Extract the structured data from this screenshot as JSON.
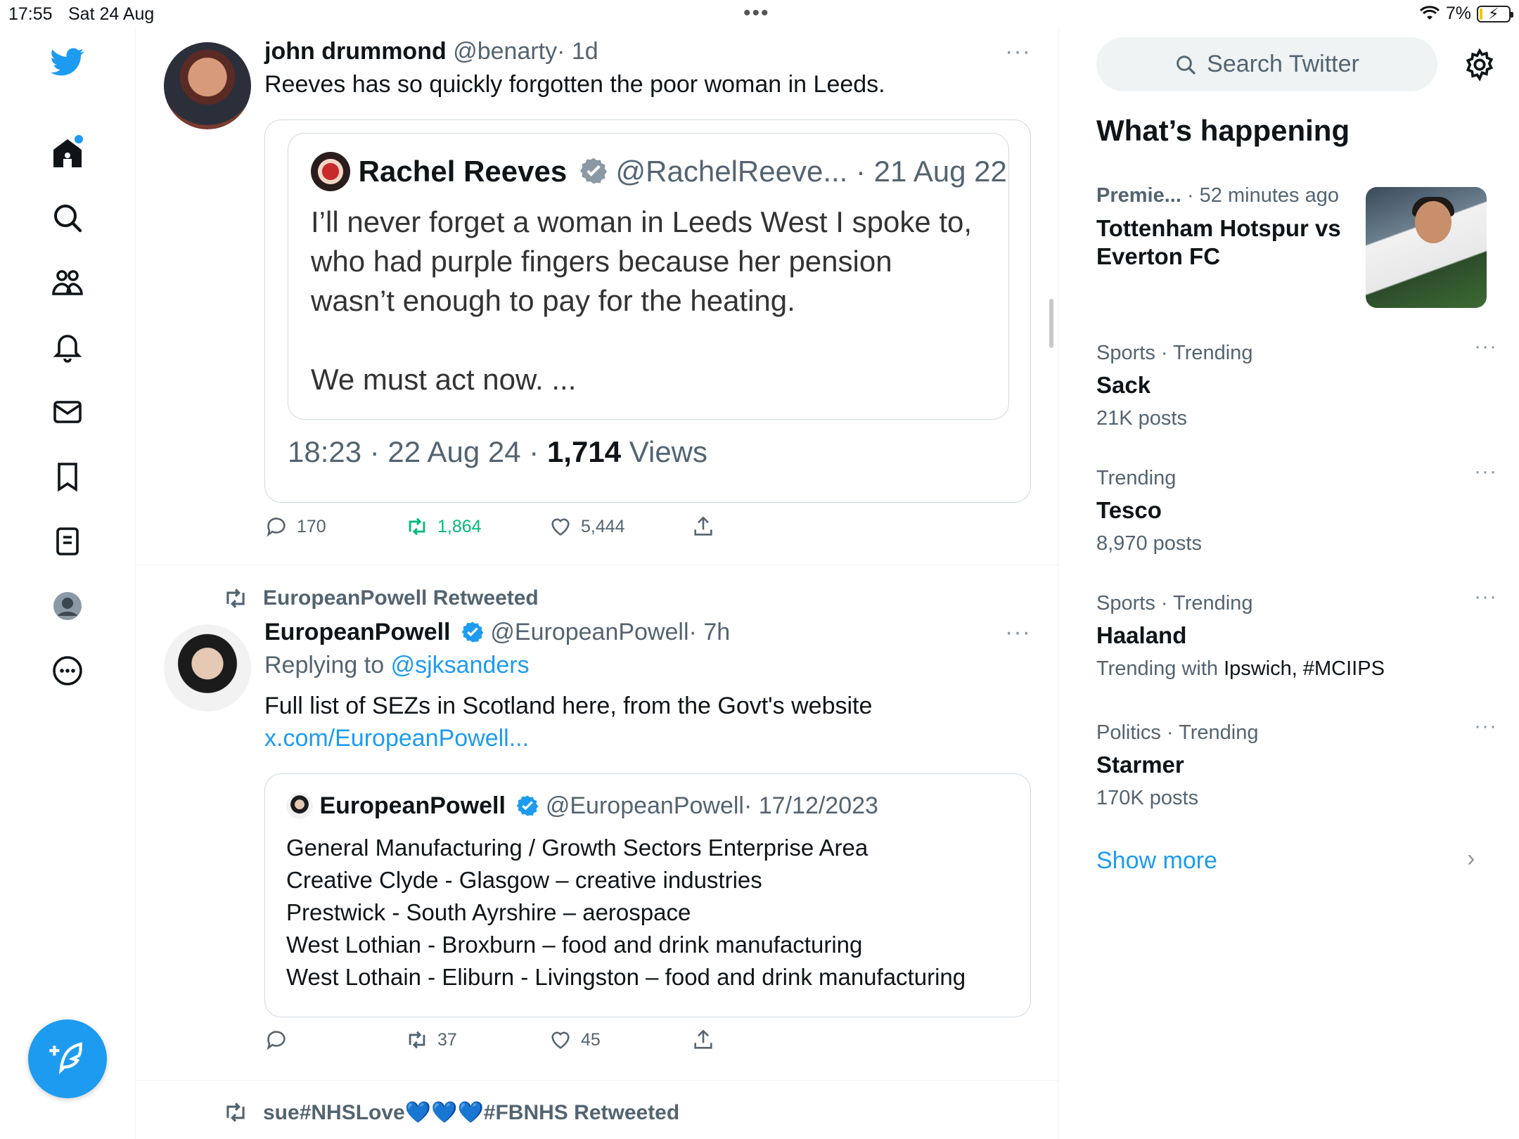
{
  "status_bar": {
    "time": "17:55",
    "date": "Sat 24 Aug",
    "dots": "•••",
    "battery": "7%"
  },
  "sidebar": {
    "icons": [
      "twitter-logo-icon",
      "home-icon",
      "search-icon",
      "communities-icon",
      "bell-icon",
      "mail-icon",
      "bookmark-icon",
      "lists-icon",
      "profile-icon",
      "more-icon"
    ],
    "compose_icon": "compose-icon",
    "accent": "#1d9bf0"
  },
  "timeline": {
    "tweets": [
      {
        "name": "john drummond",
        "handle": "@benarty",
        "time": "· 1d",
        "more": "···",
        "text": "Reeves has so quickly forgotten the poor woman in Leeds.",
        "quote": {
          "name": "Rachel Reeves",
          "handle": "@RachelReeve...",
          "date": "· 21 Aug 22",
          "text_lines": [
            "I’ll never forget a woman in Leeds West I spoke to,",
            "who had purple fingers because her pension",
            "wasn’t enough to pay for the heating.",
            "We must act now. ..."
          ],
          "timestamp": "18:23 · 22 Aug 24 ·",
          "views_count": "1,714",
          "views_label": "Views"
        },
        "replies": "170",
        "retweets": "1,864",
        "likes": "5,444"
      },
      {
        "retweeted_by": "EuropeanPowell Retweeted",
        "name": "EuropeanPowell",
        "handle": "@EuropeanPowell",
        "time": "· 7h",
        "more": "···",
        "replying_prefix": "Replying to",
        "replying_to": "@sjksanders",
        "text": "Full list of SEZs in Scotland here, from the Govt's website",
        "link": "x.com/EuropeanPowell...",
        "quote": {
          "name": "EuropeanPowell",
          "handle": "@EuropeanPowell",
          "date": "· 17/12/2023",
          "text_lines": [
            "General Manufacturing / Growth Sectors Enterprise Area",
            "Creative Clyde - Glasgow – creative industries",
            "Prestwick - South Ayrshire – aerospace",
            "West Lothian - Broxburn – food and drink manufacturing",
            "West Lothain - Eliburn - Livingston – food and drink manufacturing"
          ]
        },
        "replies": "",
        "retweets": "37",
        "likes": "45"
      },
      {
        "retweeted_by": "sue#NHSLove💙💙💙#FBNHS Retweeted"
      }
    ],
    "retweet_color": "#00ba7c"
  },
  "right": {
    "search_placeholder": "Search Twitter",
    "section_title": "What’s happening",
    "news": {
      "category": "Premie...",
      "time": "· 52 minutes ago",
      "title_line1": "Tottenham Hotspur vs",
      "title_line2": "Everton FC"
    },
    "trends": [
      {
        "meta": "Sports · Trending",
        "title": "Sack",
        "count": "21K posts"
      },
      {
        "meta": "Trending",
        "title": "Tesco",
        "count": "8,970 posts"
      },
      {
        "meta": "Sports · Trending",
        "title": "Haaland",
        "count_prefix": "Trending with",
        "count_dark": "Ipswich, #MCIIPS"
      },
      {
        "meta": "Politics · Trending",
        "title": "Starmer",
        "count": "170K posts"
      }
    ],
    "show_more": "Show more",
    "chevron": "›"
  }
}
